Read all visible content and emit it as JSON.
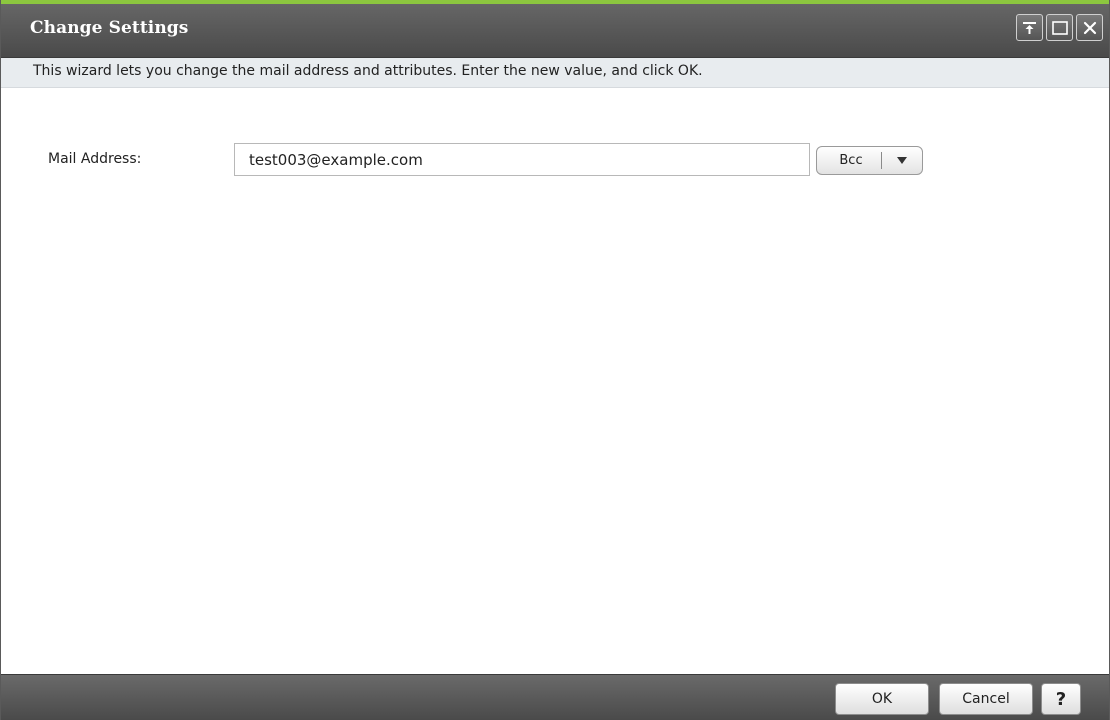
{
  "window": {
    "title": "Change Settings",
    "controls": [
      "pin-icon",
      "maximize-icon",
      "close-icon"
    ]
  },
  "description": "This wizard lets you change the mail address and attributes. Enter the new value, and click OK.",
  "form": {
    "mail_address_label": "Mail Address:",
    "mail_address_value": "test003@example.com",
    "recipient_type_selected": "Bcc",
    "recipient_type_arrow": "▼"
  },
  "footer": {
    "ok_label": "OK",
    "cancel_label": "Cancel",
    "help_label": "?"
  },
  "colors": {
    "accent": "#8cc63f",
    "titlebar": "#555555",
    "description_bar": "#e8ecef"
  }
}
